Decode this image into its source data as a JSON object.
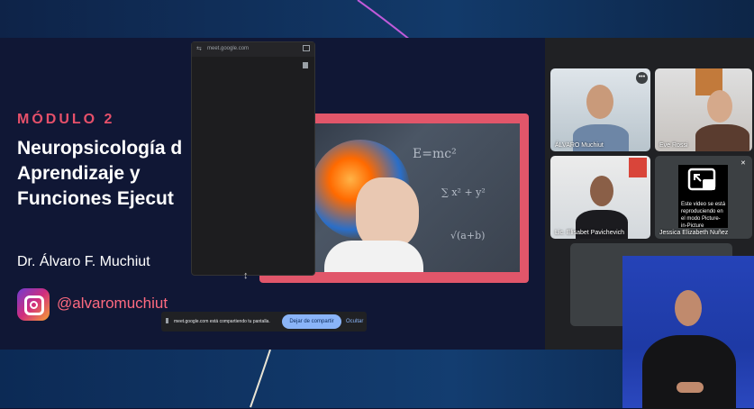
{
  "slide": {
    "module": "MÓDULO 2",
    "title_line1": "Neuropsicología d",
    "title_line2": "Aprendizaje y",
    "title_line3": "Funciones Ejecut",
    "author": "Dr. Álvaro F. Muchiut",
    "instagram_handle": "@alvaromuchiut",
    "photo_formula_1": "E=mc²",
    "photo_formula_2": "∑ x² + y²",
    "photo_formula_3": "√(a+b)"
  },
  "pip_window": {
    "url": "meet.google.com"
  },
  "share_bar": {
    "message": "meet.google.com está compartiendo tu pantalla.",
    "stop_label": "Dejar de compartir",
    "hide_label": "Ocultar"
  },
  "participants": [
    {
      "name": "ÁLVARO Muchiut"
    },
    {
      "name": "Eve Rossi"
    },
    {
      "name": "Lic. Elisabet Pavichevich"
    },
    {
      "name": "Jessica Elizabeth Nuñez"
    }
  ],
  "pip_notice": "Este video se está reproduciendo en el modo Picture-in-Picture",
  "colors": {
    "accent_pink": "#e1566a",
    "meet_blue": "#8ab4f8",
    "meet_bg": "#202124"
  }
}
